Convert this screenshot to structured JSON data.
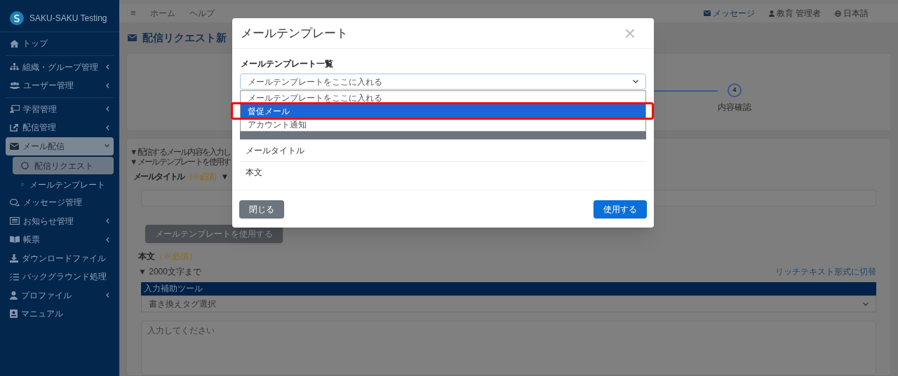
{
  "sidebar": {
    "brand": "SAKU-SAKU Testing",
    "groups": [
      [
        {
          "label": "トップ",
          "has_submenu": false,
          "expanded": false,
          "selected": false
        }
      ],
      [
        {
          "label": "組織・グループ管理",
          "has_submenu": true,
          "expanded": false,
          "selected": false
        },
        {
          "label": "ユーザー管理",
          "has_submenu": true,
          "expanded": false,
          "selected": false
        }
      ],
      [
        {
          "label": "学習管理",
          "has_submenu": true,
          "expanded": false,
          "selected": false
        },
        {
          "label": "配信管理",
          "has_submenu": true,
          "expanded": false,
          "selected": false
        },
        {
          "label": "メール配信",
          "has_submenu": true,
          "expanded": true,
          "selected": false,
          "children": [
            {
              "label": "配信リクエスト",
              "selected": true
            },
            {
              "label": "メールテンプレート",
              "selected": false
            }
          ]
        },
        {
          "label": "メッセージ管理",
          "has_submenu": false,
          "expanded": false,
          "selected": false
        },
        {
          "label": "お知らせ管理",
          "has_submenu": true,
          "expanded": false,
          "selected": false
        },
        {
          "label": "帳票",
          "has_submenu": true,
          "expanded": false,
          "selected": false
        },
        {
          "label": "ダウンロードファイル",
          "has_submenu": false,
          "expanded": false,
          "selected": false
        },
        {
          "label": "バックグラウンド処理",
          "has_submenu": false,
          "expanded": false,
          "selected": false
        },
        {
          "label": "プロファイル",
          "has_submenu": true,
          "expanded": false,
          "selected": false
        },
        {
          "label": "マニュアル",
          "has_submenu": false,
          "expanded": false,
          "selected": false
        }
      ]
    ]
  },
  "topbar": {
    "menu_glyph": "≡",
    "links": [
      "ホーム",
      "ヘルプ"
    ],
    "right": [
      "メッセージ",
      "教育 管理者",
      "日本語"
    ]
  },
  "page": {
    "title": "配信リクエスト新",
    "stepper": {
      "number": "4",
      "label": "内容確認"
    },
    "notes": [
      "▼ 配信するメール内容を入力し",
      "▼ メールテンプレートを使用す"
    ],
    "title_field": {
      "label": "メールタイトル",
      "required": "（※必須）",
      "hint": "▼"
    },
    "template_button": "メールテンプレートを使用する",
    "body_field": {
      "label": "本文",
      "required": "（※必須）",
      "hint": "▼ 2000文字まで",
      "switch_link": "リッチテキスト形式に切替",
      "toolbar": "入力補助ツール",
      "tag_select": "書き換えタグ選択",
      "placeholder": "入力してください"
    }
  },
  "modal": {
    "title": "メールテンプレート",
    "close": "×",
    "list_label": "メールテンプレート一覧",
    "select_placeholder": "メールテンプレートをここに入れる",
    "options": [
      {
        "label": "メールテンプレートをここに入れる",
        "selected": false
      },
      {
        "label": "督促メール",
        "selected": true
      },
      {
        "label": "アカウント通知",
        "selected": false
      }
    ],
    "rows": [
      "メールタイトル",
      "本文"
    ],
    "buttons": [
      {
        "label": "閉じる",
        "kind": "secondary"
      },
      {
        "label": "使用する",
        "kind": "primary"
      }
    ]
  },
  "annotation": {
    "highlight_selected_option": true
  }
}
